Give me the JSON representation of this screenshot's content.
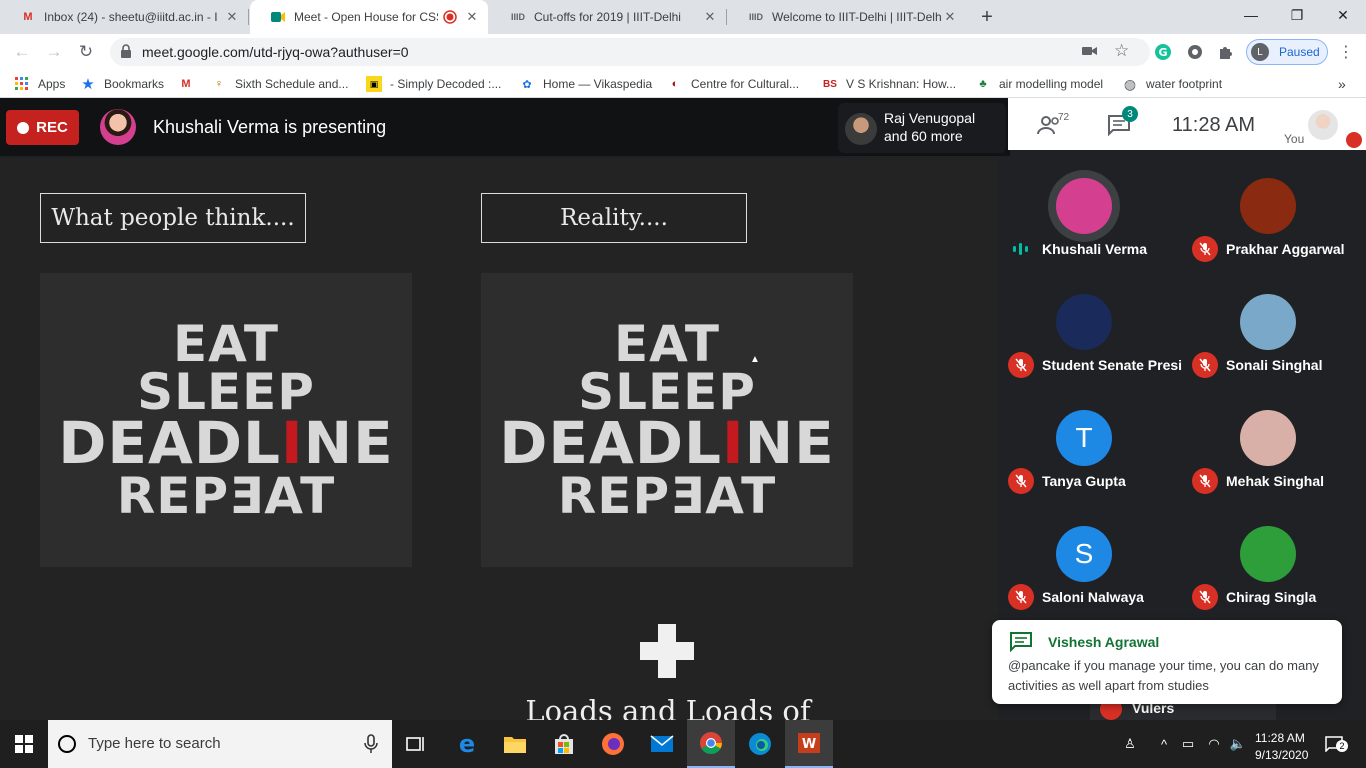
{
  "browser": {
    "tabs": [
      {
        "title": "Inbox (24) - sheetu@iiitd.ac.in - I",
        "favicon": "gmail-icon",
        "color": "#d93025"
      },
      {
        "title": "Meet - Open House for CSSS",
        "favicon": "meet-icon",
        "color": "#00897b"
      },
      {
        "title": "Cut-offs for 2019 | IIIT-Delhi",
        "favicon": "iiitd-icon",
        "color": "#5f6368"
      },
      {
        "title": "Welcome to IIIT-Delhi | IIIT-Delhi",
        "favicon": "iiitd-icon",
        "color": "#5f6368"
      }
    ],
    "new_tab_label": "+",
    "url": "meet.google.com/utd-rjyq-owa?authuser=0",
    "profile_initial": "L",
    "profile_status": "Paused",
    "bookmarks": [
      {
        "label": "Apps",
        "icon": "apps-grid-icon"
      },
      {
        "label": "Bookmarks",
        "icon": "star-icon"
      },
      {
        "label": "",
        "icon": "gmail-icon"
      },
      {
        "label": "Sixth Schedule and...",
        "icon": "bookmark-favicon"
      },
      {
        "label": "- Simply Decoded :...",
        "icon": "bookmark-favicon"
      },
      {
        "label": "Home — Vikaspedia",
        "icon": "bookmark-favicon"
      },
      {
        "label": "Centre for Cultural...",
        "icon": "bookmark-favicon"
      },
      {
        "label": "V S Krishnan: How...",
        "icon": "bs-icon"
      },
      {
        "label": "air modelling model",
        "icon": "bookmark-favicon"
      },
      {
        "label": "water footprint",
        "icon": "globe-icon"
      }
    ],
    "bookmarks_overflow": "»"
  },
  "meet": {
    "rec_label": "REC",
    "presenting_text": "Khushali Verma is presenting",
    "raj_line1": "Raj Venugopal",
    "raj_line2": "and 60 more",
    "people_count": "72",
    "chat_count": "3",
    "time": "11:28  AM",
    "you_label": "You",
    "slide": {
      "left_box": "What people think....",
      "right_box": "Reality....",
      "shirt_words": [
        "EAT",
        "SLEEP",
        "DEADL",
        "I",
        "NE",
        "REPƎAT"
      ],
      "bottom_text": "Loads and Loads of fun!!!"
    },
    "participants": [
      {
        "name": "Khushali Verma",
        "speaking": true,
        "avatar_letter": "",
        "avatar_color": "#d43f8f"
      },
      {
        "name": "Prakhar Aggarwal",
        "speaking": false,
        "avatar_letter": "",
        "avatar_color": "#8a2a10"
      },
      {
        "name": "Student Senate Presi...",
        "speaking": false,
        "avatar_letter": "",
        "avatar_color": "#1a2a5a"
      },
      {
        "name": "Sonali Singhal",
        "speaking": false,
        "avatar_letter": "",
        "avatar_color": "#7aa8c8"
      },
      {
        "name": "Tanya Gupta",
        "speaking": false,
        "avatar_letter": "T",
        "avatar_color": "#1e88e5"
      },
      {
        "name": "Mehak Singhal",
        "speaking": false,
        "avatar_letter": "",
        "avatar_color": "#d8b0a8"
      },
      {
        "name": "Saloni Nalwaya",
        "speaking": false,
        "avatar_letter": "S",
        "avatar_color": "#1e88e5"
      },
      {
        "name": "Chirag Singla",
        "speaking": false,
        "avatar_letter": "",
        "avatar_color": "#2e9e3a"
      }
    ],
    "chat_toast": {
      "from": "Vishesh Agrawal",
      "message": "@pancake if you manage your time, you can do many activities as well apart from studies"
    },
    "partial_participant": "Vulers"
  },
  "taskbar": {
    "search_placeholder": "Type here to search",
    "time": "11:28 AM",
    "date": "9/13/2020",
    "notification_count": "2"
  },
  "colors": {
    "rec_red": "#c5221f",
    "mic_off_red": "#d93025",
    "meet_bg": "#202124",
    "speaking_teal": "#00bfa5"
  }
}
